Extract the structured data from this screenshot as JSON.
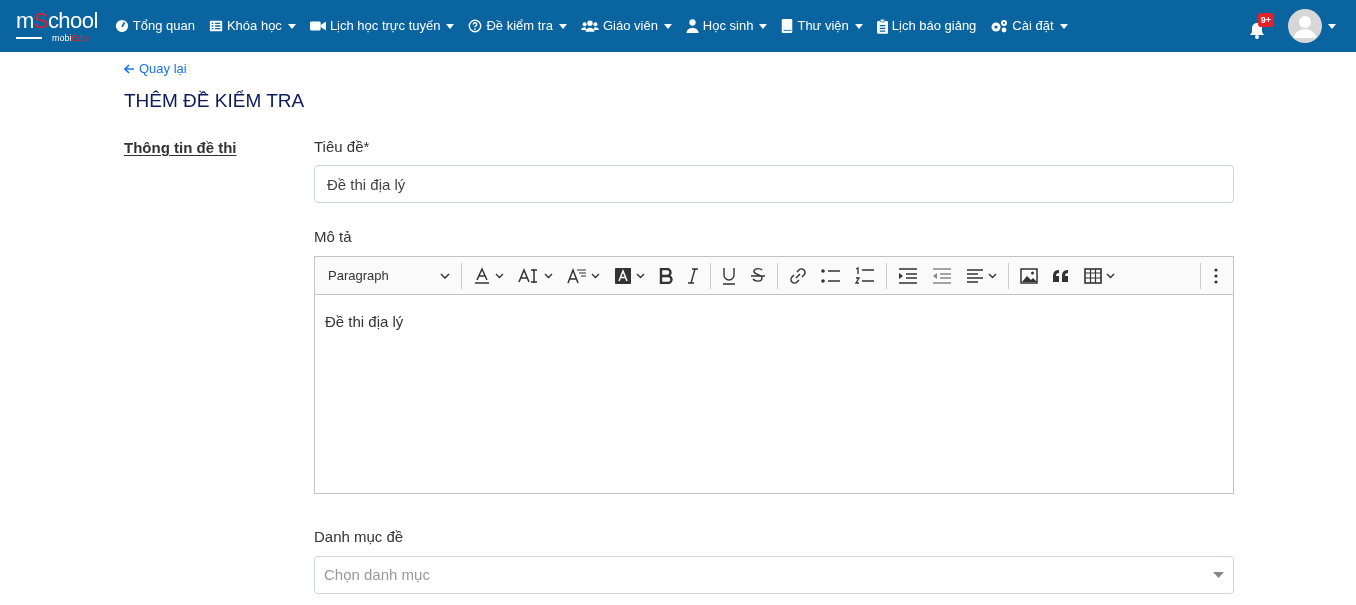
{
  "logo": {
    "before": "m",
    "highlight": "S",
    "after": "chool",
    "sub_before": "mobi",
    "sub_highlight": "Edu"
  },
  "nav": [
    {
      "label": "Tổng quan",
      "has_menu": false
    },
    {
      "label": "Khóa học",
      "has_menu": true
    },
    {
      "label": "Lịch học trực tuyến",
      "has_menu": true
    },
    {
      "label": "Đề kiểm tra",
      "has_menu": true
    },
    {
      "label": "Giáo viên",
      "has_menu": true
    },
    {
      "label": "Học sinh",
      "has_menu": true
    },
    {
      "label": "Thư viện",
      "has_menu": true
    },
    {
      "label": "Lịch báo giảng",
      "has_menu": false
    },
    {
      "label": "Cài đặt",
      "has_menu": true
    }
  ],
  "notifications": {
    "badge": "9+"
  },
  "back_link": "Quay lại",
  "page_title": "THÊM ĐỀ KIỂM TRA",
  "section_label": "Thông tin đề thi",
  "form": {
    "title_label": "Tiêu đề*",
    "title_value": "Đề thi địa lý",
    "description_label": "Mô tả",
    "editor": {
      "heading_select": "Paragraph",
      "content": "Đề thi địa lý"
    },
    "category_label": "Danh mục đề",
    "category_placeholder": "Chọn danh mục"
  }
}
